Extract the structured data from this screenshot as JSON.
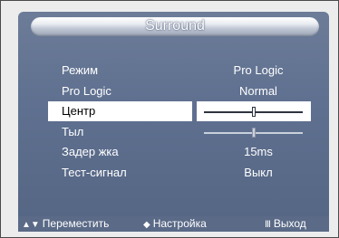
{
  "title": "Surround",
  "menu": {
    "items": [
      {
        "label": "Режим",
        "value": "Pro Logic"
      },
      {
        "label": "Pro Logic",
        "value": "Normal"
      },
      {
        "label": "Центр",
        "slider": 0.5
      },
      {
        "label": "Тыл",
        "slider": 0.5
      },
      {
        "label": "Задер жка",
        "value": "15ms"
      },
      {
        "label": "Тест-сигнал",
        "value": "Выкл"
      }
    ]
  },
  "footer": {
    "move": {
      "icon": "▲▼",
      "label": "Переместить"
    },
    "adjust": {
      "icon": "◆",
      "label": "Настройка"
    },
    "exit": {
      "icon": "Ⅲ",
      "label": "Выход"
    }
  },
  "colors": {
    "osd_background": "#5f7090",
    "highlight": "#ffffff",
    "text": "#ffffff"
  },
  "selected_index": 2
}
